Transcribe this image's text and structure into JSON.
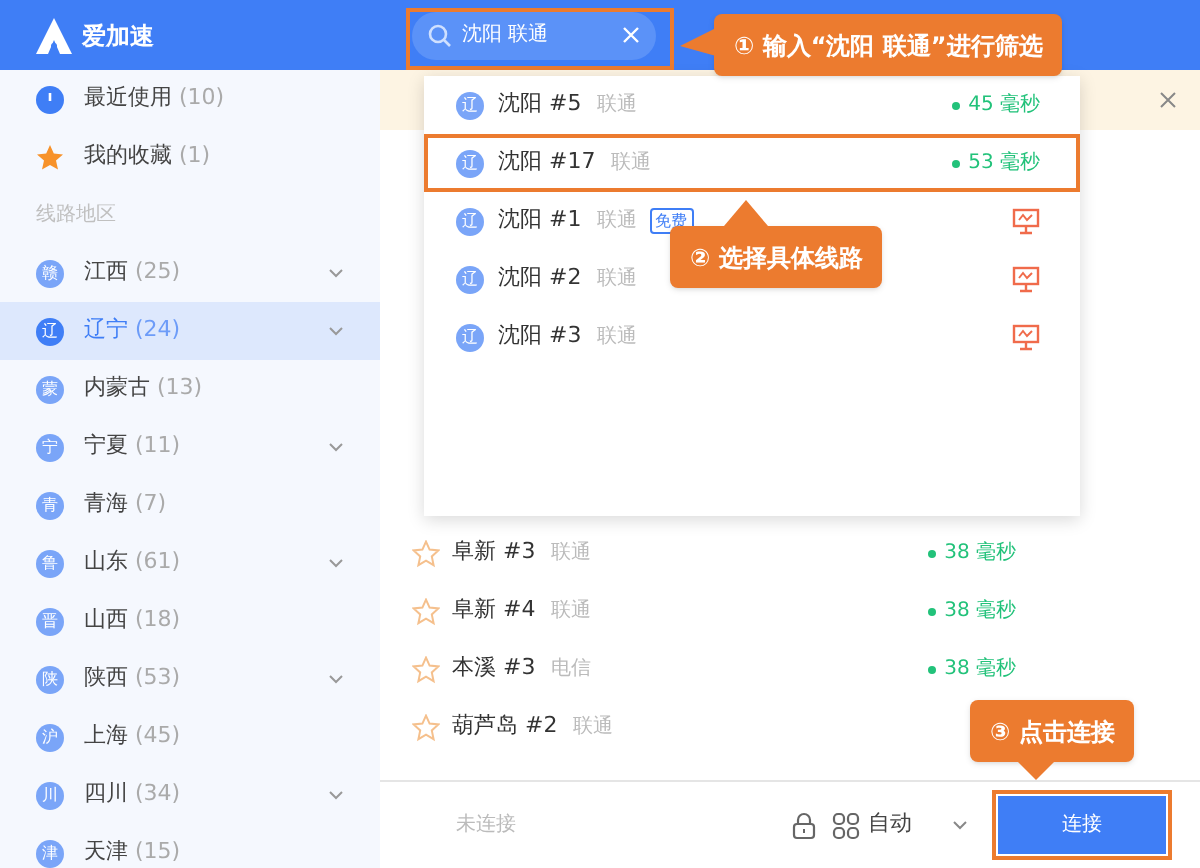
{
  "app": {
    "name": "爱加速"
  },
  "search": {
    "value": "沈阳 联通"
  },
  "sidebar": {
    "quick": [
      {
        "kind": "recent",
        "label": "最近使用",
        "count": "(10)"
      },
      {
        "kind": "favorite",
        "label": "我的收藏",
        "count": "(1)"
      }
    ],
    "section_title": "线路地区",
    "regions": [
      {
        "badge": "赣",
        "label": "江西",
        "count": "(25)",
        "expandable": true,
        "selected": false
      },
      {
        "badge": "辽",
        "label": "辽宁",
        "count": "(24)",
        "expandable": true,
        "selected": true
      },
      {
        "badge": "蒙",
        "label": "内蒙古",
        "count": "(13)",
        "expandable": false,
        "selected": false
      },
      {
        "badge": "宁",
        "label": "宁夏",
        "count": "(11)",
        "expandable": true,
        "selected": false
      },
      {
        "badge": "青",
        "label": "青海",
        "count": "(7)",
        "expandable": false,
        "selected": false
      },
      {
        "badge": "鲁",
        "label": "山东",
        "count": "(61)",
        "expandable": true,
        "selected": false
      },
      {
        "badge": "晋",
        "label": "山西",
        "count": "(18)",
        "expandable": false,
        "selected": false
      },
      {
        "badge": "陕",
        "label": "陕西",
        "count": "(53)",
        "expandable": true,
        "selected": false
      },
      {
        "badge": "沪",
        "label": "上海",
        "count": "(45)",
        "expandable": false,
        "selected": false
      },
      {
        "badge": "川",
        "label": "四川",
        "count": "(34)",
        "expandable": true,
        "selected": false
      },
      {
        "badge": "津",
        "label": "天津",
        "count": "(15)",
        "expandable": false,
        "selected": false
      }
    ]
  },
  "servers": [
    {
      "name": "阜新 #3",
      "isp": "联通",
      "latency": "38 毫秒"
    },
    {
      "name": "阜新 #4",
      "isp": "联通",
      "latency": "38 毫秒"
    },
    {
      "name": "本溪 #3",
      "isp": "电信",
      "latency": "38 毫秒"
    },
    {
      "name": "葫芦岛 #2",
      "isp": "联通"
    }
  ],
  "dropdown": [
    {
      "badge": "辽",
      "name": "沈阳 #5",
      "isp": "联通",
      "kind": "latency",
      "latency": "45 毫秒",
      "selected": false
    },
    {
      "badge": "辽",
      "name": "沈阳 #17",
      "isp": "联通",
      "kind": "latency",
      "latency": "53 毫秒",
      "selected": true
    },
    {
      "badge": "辽",
      "name": "沈阳 #1",
      "isp": "联通",
      "tag": "免费",
      "kind": "offline",
      "selected": false
    },
    {
      "badge": "辽",
      "name": "沈阳 #2",
      "isp": "联通",
      "kind": "offline",
      "selected": false
    },
    {
      "badge": "辽",
      "name": "沈阳 #3",
      "isp": "联通",
      "kind": "offline",
      "selected": false
    }
  ],
  "footer": {
    "status": "未连接",
    "mode": "自动",
    "connect": "连接"
  },
  "callouts": [
    "① 输入“沈阳 联通”进行筛选",
    "② 选择具体线路",
    "③ 点击连接"
  ]
}
